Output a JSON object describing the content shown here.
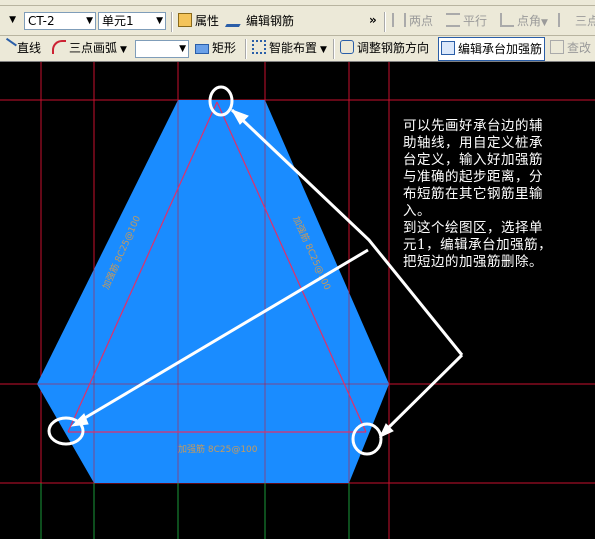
{
  "toolbar1": {
    "level_value": "CT-2",
    "unit_value": "单元1",
    "attr_label": "属性",
    "edit_rebar_label": "编辑钢筋",
    "more_glyph": "»",
    "two_points_label": "两点",
    "parallel_label": "平行",
    "point_angle_label": "点角",
    "three_points_label": "三点"
  },
  "toolbar2": {
    "line_label": "直线",
    "arc_label": "三点画弧",
    "rect_label": "矩形",
    "smart_layout_label": "智能布置",
    "adjust_dir_label": "调整钢筋方向",
    "edit_rebar_label": "编辑承台加强筋",
    "view_label": "查改"
  },
  "drawing": {
    "rebar_labels": [
      "加强筋 8C25@100",
      "加强筋 8C25@100",
      "加强筋 8C25@100"
    ],
    "fill_color": "#1a8cff",
    "grid_color": "#c8102e",
    "rebar_color": "#e0306a",
    "annotation_color": "#ffffff"
  },
  "note": {
    "lines": [
      "可以先画好承台边的辅",
      "助轴线，用自定义桩承",
      "台定义，输入好加强筋",
      "与准确的起步距离，分",
      "布短筋在其它钢筋里输",
      "入。",
      "到这个绘图区，选择单",
      "元1，编辑承台加强筋，",
      "把短边的加强筋删除。"
    ]
  }
}
